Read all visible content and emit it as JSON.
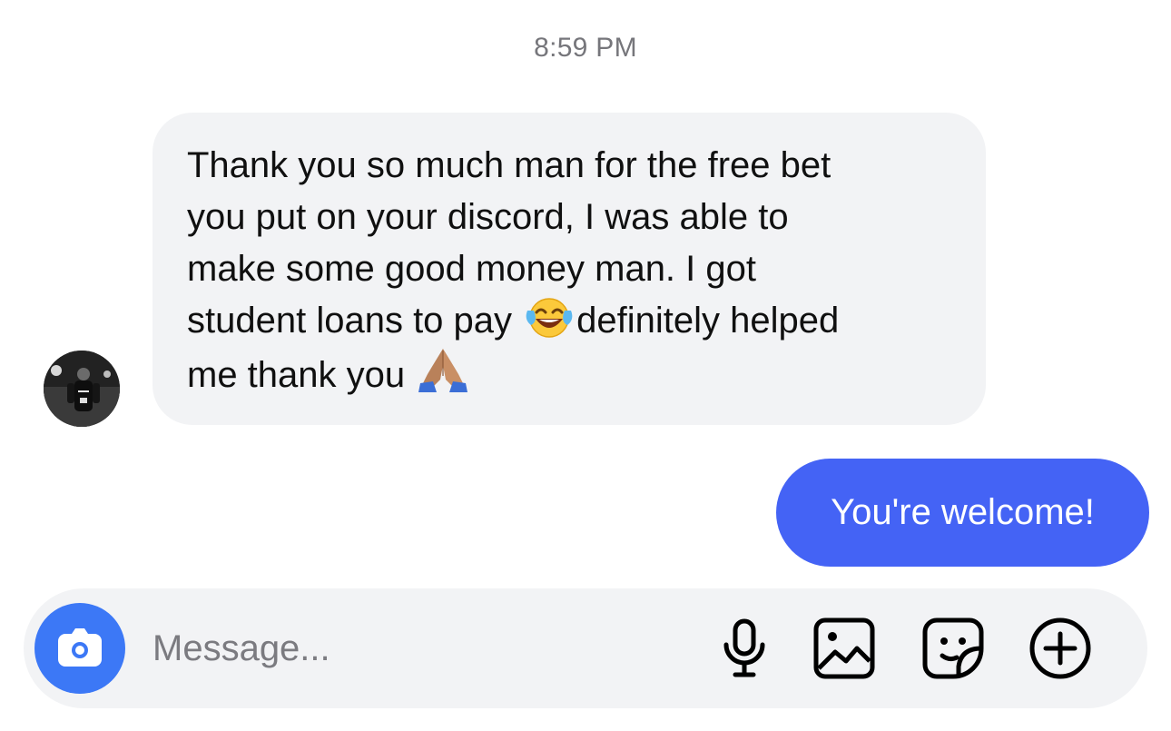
{
  "conversation": {
    "timestamp": "8:59 PM",
    "incoming": {
      "avatar_icon": "profile-photo",
      "lines": [
        "Thank you so much man for the free bet",
        "you put on your discord, I was able to",
        "make some good money man. I got",
        "student loans to pay ",
        "definitely helped",
        "me thank you "
      ],
      "emojis": [
        "face-with-tears-of-joy",
        "folded-hands"
      ]
    },
    "outgoing": {
      "text": "You're welcome!",
      "color": "#4463f5"
    }
  },
  "composer": {
    "placeholder": "Message...",
    "value": "",
    "icons": [
      "camera-icon",
      "microphone-icon",
      "gallery-icon",
      "sticker-icon",
      "add-icon"
    ],
    "camera_color": "#3c78f6"
  }
}
